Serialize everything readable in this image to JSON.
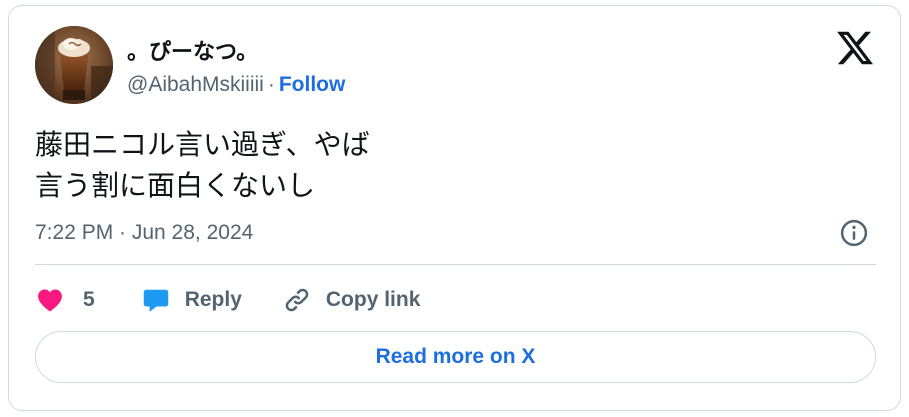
{
  "author": {
    "display_name": "。ぴーなつ。",
    "handle": "@AibahMskiiiii",
    "separator": "·",
    "follow_label": "Follow",
    "avatar_icon": "avatar-photo-drink"
  },
  "tweet": {
    "text": "藤田ニコル言い過ぎ、やば\n言う割に面白くないし",
    "timestamp": "7:22 PM · Jun 28, 2024"
  },
  "actions": {
    "like_count": "5",
    "reply_label": "Reply",
    "copy_link_label": "Copy link"
  },
  "footer": {
    "read_more_label": "Read more on X"
  },
  "colors": {
    "accent": "#1d6fe0",
    "like": "#f91880",
    "reply_icon": "#1d9bf0",
    "secondary_text": "#536471",
    "border": "#cfd9de"
  },
  "icons": [
    "x-logo-icon",
    "info-icon",
    "heart-icon",
    "reply-bubble-icon",
    "link-icon"
  ]
}
